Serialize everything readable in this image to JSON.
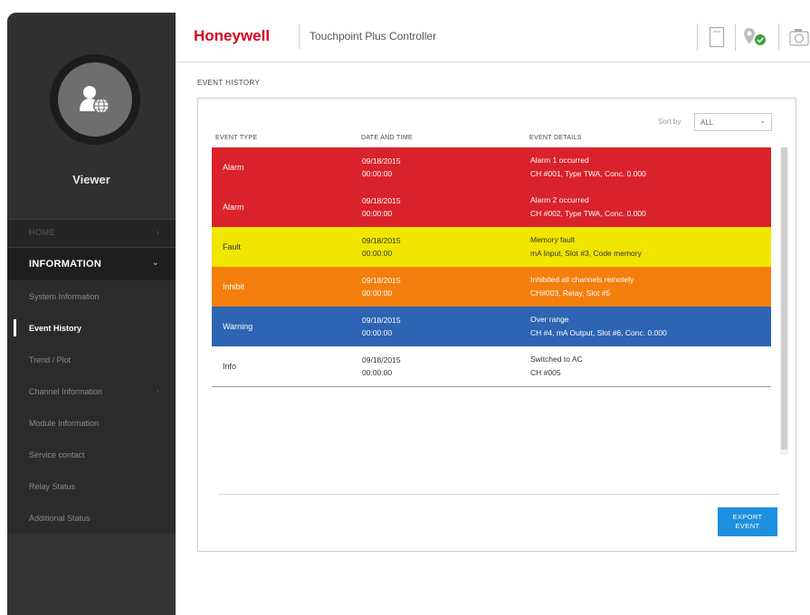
{
  "header": {
    "brand": "Honeywell",
    "app_title": "Touchpoint Plus Controller",
    "icons": [
      "document-icon",
      "location-pin-check-icon",
      "camera-icon"
    ]
  },
  "sidebar": {
    "user_role": "Viewer",
    "home_label": "HOME",
    "section_label": "INFORMATION",
    "items": [
      {
        "label": "System Information"
      },
      {
        "label": "Event History"
      },
      {
        "label": "Trend / Plot"
      },
      {
        "label": "Channel Information"
      },
      {
        "label": "Module Information"
      },
      {
        "label": "Service contact"
      },
      {
        "label": "Relay Status"
      },
      {
        "label": "Additional Status"
      }
    ]
  },
  "main": {
    "section_title": "EVENT HISTORY",
    "sort_label": "Sort by",
    "sort_value": "ALL",
    "columns": [
      "EVENT TYPE",
      "DATE AND TIME",
      "EVENT DETAILS"
    ],
    "events": [
      {
        "type": "Alarm",
        "date": "09/18/2015",
        "time": "00:00:00",
        "detail1": "Alarm 1 occurred",
        "detail2": "CH #001, Type TWA, Conc. 0.000",
        "bg": "#d9222a",
        "fg": "#ffffff"
      },
      {
        "type": "Alarm",
        "date": "09/18/2015",
        "time": "00:00:00",
        "detail1": "Alarm 2 occurred",
        "detail2": "CH #002, Type TWA, Conc. 0.000",
        "bg": "#d9222a",
        "fg": "#ffffff"
      },
      {
        "type": "Fault",
        "date": "09/18/2015",
        "time": "00:00:00",
        "detail1": "Memory fault",
        "detail2": "mA Input, Slot #3, Code memory",
        "bg": "#f0e600",
        "fg": "#333333"
      },
      {
        "type": "Inhibit",
        "date": "09/18/2015",
        "time": "00:00:00",
        "detail1": "Inhibited all channels remotely",
        "detail2": "CH#003, Relay, Slot #5",
        "bg": "#f47f0d",
        "fg": "#ffffff"
      },
      {
        "type": "Warning",
        "date": "09/18/2015",
        "time": "00:00:00",
        "detail1": "Over range",
        "detail2": "CH #4, mA Output, Slot #6, Conc. 0.000",
        "bg": "#2d64b3",
        "fg": "#ffffff"
      },
      {
        "type": "Info",
        "date": "09/18/2015",
        "time": "00:00:00",
        "detail1": "Switched to AC",
        "detail2": "CH #005",
        "bg": "#ffffff",
        "fg": "#333333"
      }
    ],
    "export_line1": "EXPORT",
    "export_line2": "EVENT"
  }
}
